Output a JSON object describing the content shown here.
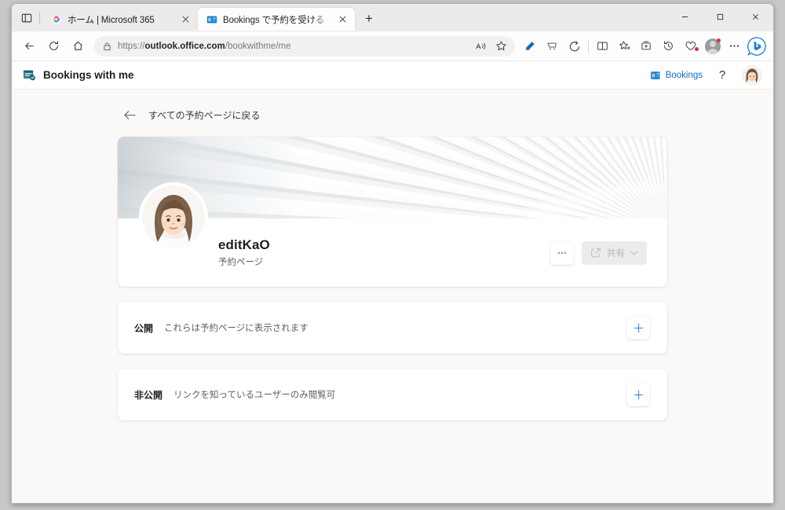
{
  "browser": {
    "tabs": [
      {
        "title": "ホーム | Microsoft 365",
        "favicon": "microsoft365-icon",
        "active": false
      },
      {
        "title": "Bookings で予約を受ける - editKaO",
        "favicon": "outlook-icon",
        "active": true
      }
    ],
    "new_tab_label": "+",
    "tab_search_name": "tab-search-icon",
    "window_controls": {
      "minimize": "—",
      "maximize": "▢",
      "close": "✕"
    },
    "nav": {
      "back": "←",
      "refresh": "⟳",
      "home": "⌂"
    },
    "address": {
      "scheme": "https://",
      "host": "outlook.office.com",
      "path": "/bookwithme/me",
      "lock": "lock-icon"
    },
    "omnibox_icons": [
      "read-aloud-icon",
      "favorite-star-icon"
    ],
    "toolbar_icons": [
      "editor-icon",
      "shopping-icon",
      "copilot-icon",
      "split-screen-icon",
      "add-favorite-icon",
      "collections-icon",
      "history-icon",
      "browser-essentials-icon",
      "profile-avatar-icon",
      "settings-more-icon",
      "bing-icon"
    ]
  },
  "app": {
    "brand": {
      "icon": "bookings-icon",
      "title": "Bookings with me"
    },
    "header_right": {
      "bookings_link": {
        "icon": "outlook-bookings-icon",
        "label": "Bookings"
      },
      "help_label": "?",
      "avatar_name": "user-avatar"
    },
    "back_link": {
      "arrow": "←",
      "label": "すべての予約ページに戻る"
    },
    "profile": {
      "name": "editKaO",
      "subtitle": "予約ページ",
      "more_label": "…",
      "share_label": "共有",
      "share_icon": "share-icon",
      "share_chevron": "⌄",
      "banner_name": "profile-banner-image",
      "avatar_name": "profile-avatar-image"
    },
    "sections": [
      {
        "label": "公開",
        "description": "これらは予約ページに表示されます",
        "add_label": "+"
      },
      {
        "label": "非公開",
        "description": "リンクを知っているユーザーのみ閲覧可",
        "add_label": "+"
      }
    ]
  },
  "colors": {
    "accent": "#0f6cbd",
    "plus_blue": "#4f8ef7",
    "page_bg": "#faf9f8",
    "card_bg": "#ffffff",
    "text_primary": "#201f1e",
    "text_secondary": "#605e5c"
  }
}
